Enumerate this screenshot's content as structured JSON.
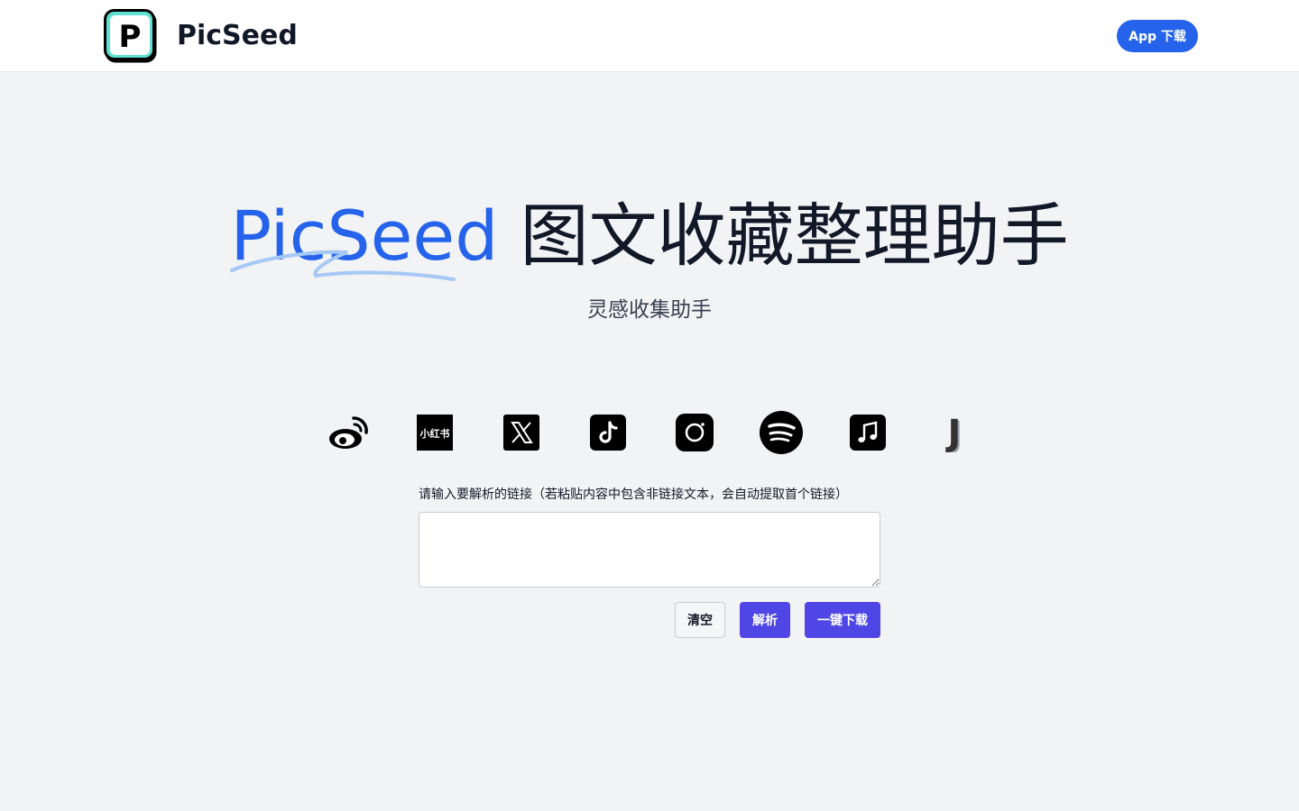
{
  "header": {
    "brand": "PicSeed",
    "logo_letter": "P",
    "app_download_label": "App 下载"
  },
  "hero": {
    "brand_word": "PicSeed",
    "title_rest": "图文收藏整理助手",
    "subtitle": "灵感收集助手"
  },
  "platforms": [
    {
      "name": "weibo-icon"
    },
    {
      "name": "xiaohongshu-icon",
      "label": "小红书"
    },
    {
      "name": "x-twitter-icon"
    },
    {
      "name": "tiktok-icon"
    },
    {
      "name": "instagram-icon"
    },
    {
      "name": "spotify-icon"
    },
    {
      "name": "apple-music-icon"
    },
    {
      "name": "jike-icon",
      "label": "J"
    }
  ],
  "form": {
    "label": "请输入要解析的链接（若粘贴内容中包含非链接文本，会自动提取首个链接）",
    "value": "",
    "clear_label": "清空",
    "parse_label": "解析",
    "download_label": "一键下载"
  },
  "colors": {
    "brand_blue": "#2563eb",
    "button_indigo": "#4f46e5",
    "page_bg": "#f2f3f5",
    "logo_teal": "#3ecfc0"
  }
}
